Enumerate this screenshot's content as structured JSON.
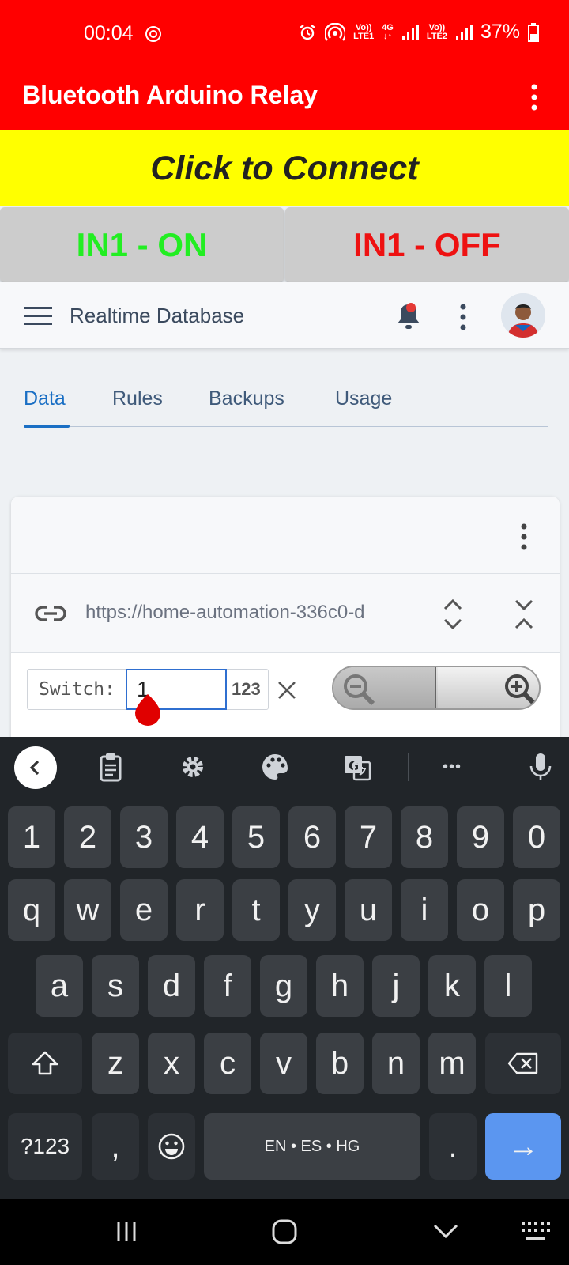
{
  "status_bar": {
    "time": "00:04",
    "net1_label_top": "Vo))",
    "net1_label_bottom": "LTE1",
    "net_4g": "4G",
    "net2_label_top": "Vo))",
    "net2_label_bottom": "LTE2",
    "battery": "37%",
    "battery_color": "#ffffff"
  },
  "app_bar": {
    "title": "Bluetooth Arduino Relay",
    "background": "#ff0000"
  },
  "connect_button": {
    "label": "Click to Connect",
    "background": "#ffff00"
  },
  "relay_buttons": {
    "on_label": "IN1 - ON",
    "off_label": "IN1 - OFF",
    "on_color": "#22ee22",
    "off_color": "#ee1111"
  },
  "firebase_header": {
    "title": "Realtime Database"
  },
  "tabs": [
    {
      "label": "Data",
      "active": true
    },
    {
      "label": "Rules",
      "active": false
    },
    {
      "label": "Backups",
      "active": false
    },
    {
      "label": "Usage",
      "active": false
    }
  ],
  "data_card": {
    "url": "https://home-automation-336c0-d"
  },
  "find_bar": {
    "label": "Switch:",
    "value": "1",
    "mode_label": "123"
  },
  "keyboard": {
    "row_numbers": [
      "1",
      "2",
      "3",
      "4",
      "5",
      "6",
      "7",
      "8",
      "9",
      "0"
    ],
    "row_top": [
      "q",
      "w",
      "e",
      "r",
      "t",
      "y",
      "u",
      "i",
      "o",
      "p"
    ],
    "row_middle": [
      "a",
      "s",
      "d",
      "f",
      "g",
      "h",
      "j",
      "k",
      "l"
    ],
    "row_bottom": [
      "z",
      "x",
      "c",
      "v",
      "b",
      "n",
      "m"
    ],
    "symbols_key": "?123",
    "comma_key": ",",
    "space_label": "EN • ES • HG",
    "period_key": ".",
    "enter_key": "→",
    "toolbar_more": "•••"
  }
}
